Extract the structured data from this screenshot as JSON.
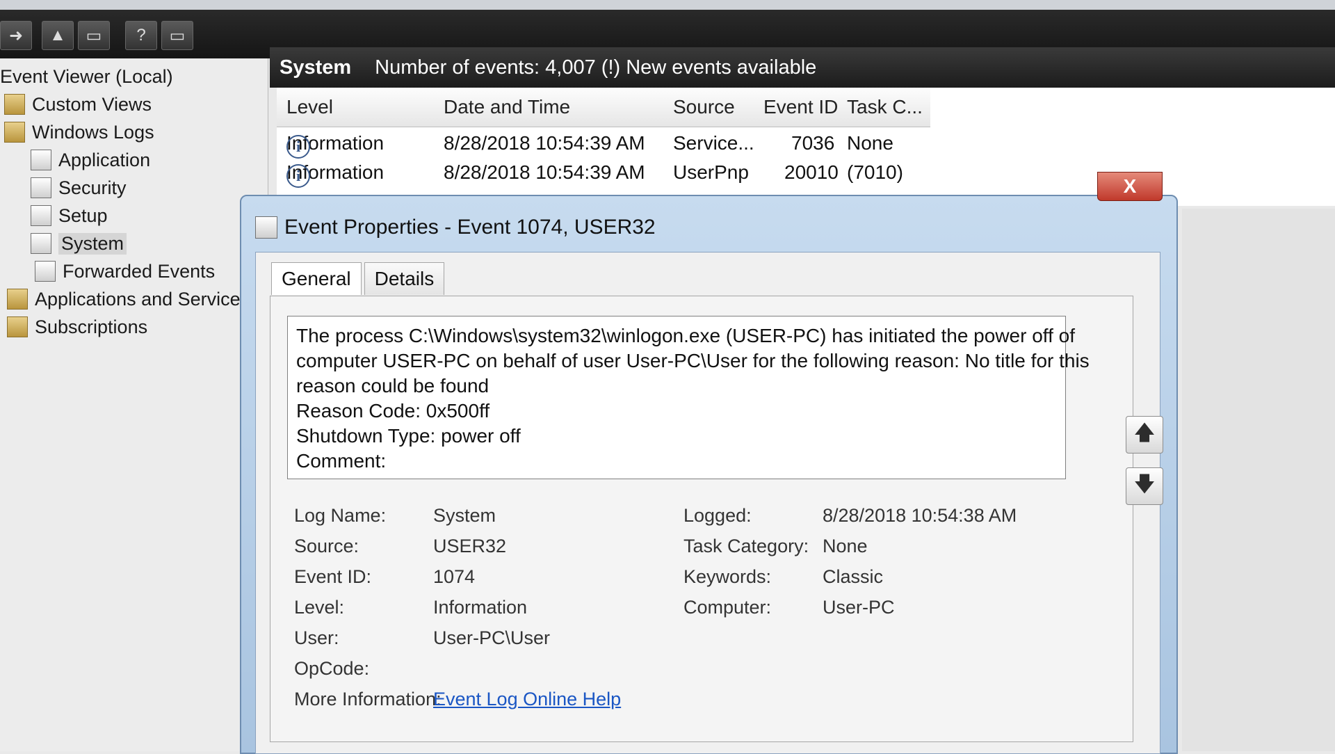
{
  "tree": {
    "root": "Event Viewer (Local)",
    "items": [
      {
        "label": "Custom Views"
      },
      {
        "label": "Windows Logs"
      },
      {
        "label": "Application"
      },
      {
        "label": "Security"
      },
      {
        "label": "Setup"
      },
      {
        "label": "System"
      },
      {
        "label": "Forwarded Events"
      },
      {
        "label": "Applications and Service"
      },
      {
        "label": "Subscriptions"
      }
    ]
  },
  "list": {
    "name": "System",
    "count_text": "Number of events: 4,007 (!) New events available",
    "columns": [
      "Level",
      "Date and Time",
      "Source",
      "Event ID",
      "Task C..."
    ],
    "rows": [
      {
        "level": "Information",
        "datetime": "8/28/2018 10:54:39 AM",
        "source": "Service...",
        "event_id": "7036",
        "task": "None"
      },
      {
        "level": "Information",
        "datetime": "8/28/2018 10:54:39 AM",
        "source": "UserPnp",
        "event_id": "20010",
        "task": "(7010)"
      }
    ]
  },
  "dialog": {
    "title": "Event Properties - Event 1074, USER32",
    "close": "X",
    "tabs": [
      "General",
      "Details"
    ],
    "description": [
      "The process C:\\Windows\\system32\\winlogon.exe (USER-PC) has initiated the power off of",
      "computer USER-PC on behalf of user User-PC\\User for the following reason: No title for this",
      "reason could be found",
      " Reason Code: 0x500ff",
      " Shutdown Type: power off",
      " Comment:"
    ],
    "fields": {
      "log_name_label": "Log Name:",
      "log_name": "System",
      "source_label": "Source:",
      "source": "USER32",
      "event_id_label": "Event ID:",
      "event_id": "1074",
      "level_label": "Level:",
      "level": "Information",
      "user_label": "User:",
      "user": "User-PC\\User",
      "opcode_label": "OpCode:",
      "opcode": "",
      "more_info_label": "More Information:",
      "more_info_link": "Event Log Online Help",
      "logged_label": "Logged:",
      "logged": "8/28/2018 10:54:38 AM",
      "task_category_label": "Task Category:",
      "task_category": "None",
      "keywords_label": "Keywords:",
      "keywords": "Classic",
      "computer_label": "Computer:",
      "computer": "User-PC"
    }
  },
  "icons": {
    "info": "i",
    "up": "🡅",
    "down": "🡇",
    "help": "?"
  }
}
